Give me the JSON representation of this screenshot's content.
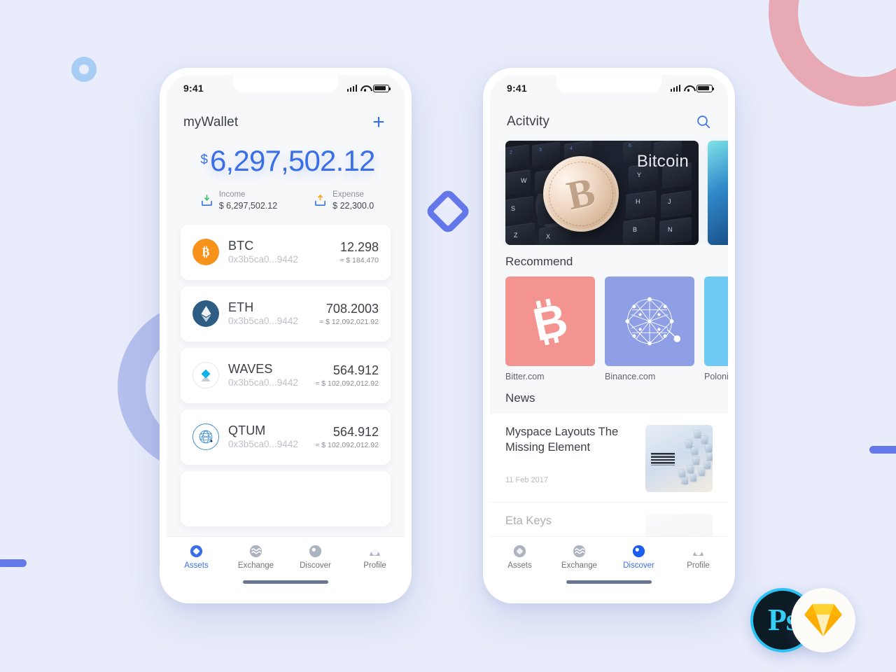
{
  "canvas": {
    "background": "#e8ecfb"
  },
  "decor": {
    "ring_pink": "#e6a3ae",
    "ring_periwinkle": "#b2bdec",
    "circle_small": "#a8cdf5",
    "diamond": "#6478ea",
    "bar": "#6478ea"
  },
  "accent": "#3a6fe8",
  "wallet_screen": {
    "status": {
      "time": "9:41",
      "signal_icon": "cellular-signal-icon",
      "wifi_icon": "wifi-icon",
      "battery_icon": "battery-icon"
    },
    "header": {
      "title": "myWallet",
      "add_icon": "plus-icon"
    },
    "balance": {
      "currency_symbol": "$",
      "amount": "6,297,502.12"
    },
    "stats": [
      {
        "icon": "income-download-icon",
        "label": "Income",
        "value": "$ 6,297,502.12",
        "arrow_color": "#3bbf6e"
      },
      {
        "icon": "expense-upload-icon",
        "label": "Expense",
        "value": "$ 22,300.0",
        "arrow_color": "#f5a623"
      }
    ],
    "assets": [
      {
        "icon": "bitcoin-coin-icon",
        "symbol": "BTC",
        "address": "0x3b5ca0...9442",
        "quantity": "12.298",
        "fiat": "≈ $ 184,470",
        "color": "#f7931a"
      },
      {
        "icon": "ethereum-coin-icon",
        "symbol": "ETH",
        "address": "0x3b5ca0...9442",
        "quantity": "708.2003",
        "fiat": "≈ $ 12,092,021.92",
        "color": "#2d5d82"
      },
      {
        "icon": "waves-coin-icon",
        "symbol": "WAVES",
        "address": "0x3b5ca0...9442",
        "quantity": "564.912",
        "fiat": "≈ $ 102,092,012.92",
        "color": "#0fb2e5"
      },
      {
        "icon": "qtum-coin-icon",
        "symbol": "QTUM",
        "address": "0x3b5ca0...9442",
        "quantity": "564.912",
        "fiat": "≈ $ 102,092,012.92",
        "color": "#2e9ad0"
      }
    ],
    "tabs": [
      {
        "label": "Assets",
        "icon": "assets-diamond-icon",
        "active": true
      },
      {
        "label": "Exchange",
        "icon": "exchange-waves-icon",
        "active": false
      },
      {
        "label": "Discover",
        "icon": "discover-compass-icon",
        "active": false
      },
      {
        "label": "Profile",
        "icon": "profile-person-icon",
        "active": false
      }
    ]
  },
  "activity_screen": {
    "status": {
      "time": "9:41",
      "signal_icon": "cellular-signal-icon",
      "wifi_icon": "wifi-icon",
      "battery_icon": "battery-icon"
    },
    "header": {
      "title": "Acitvity",
      "search_icon": "search-icon"
    },
    "banners": [
      {
        "caption": "Bitcoin",
        "image": "bitcoin-coin-on-keyboard-photo"
      },
      {
        "caption": "",
        "image": "teal-abstract-photo"
      }
    ],
    "recommend": {
      "title": "Recommend",
      "items": [
        {
          "name": "Bitter.com",
          "icon": "bitcoin-b-icon",
          "color": "#f39490"
        },
        {
          "name": "Binance.com",
          "icon": "binance-mesh-icon",
          "color": "#8e9fe5"
        },
        {
          "name": "Poloniex.com",
          "icon": "poloniex-icon",
          "color": "#6ec9f5"
        }
      ]
    },
    "news": {
      "title": "News",
      "items": [
        {
          "title": "Myspace Layouts The Missing Element",
          "date": "11 Feb 2017",
          "thumb": "ibm-server-photo"
        },
        {
          "title": "Eta Keys",
          "date": "",
          "thumb": "person-portrait-photo"
        }
      ]
    },
    "tabs": [
      {
        "label": "Assets",
        "icon": "assets-diamond-icon",
        "active": false
      },
      {
        "label": "Exchange",
        "icon": "exchange-waves-icon",
        "active": false
      },
      {
        "label": "Discover",
        "icon": "discover-compass-icon",
        "active": true
      },
      {
        "label": "Profile",
        "icon": "profile-person-icon",
        "active": false
      }
    ]
  },
  "badges": [
    {
      "name": "photoshop-badge",
      "label": "Ps"
    },
    {
      "name": "sketch-badge",
      "label": ""
    }
  ]
}
